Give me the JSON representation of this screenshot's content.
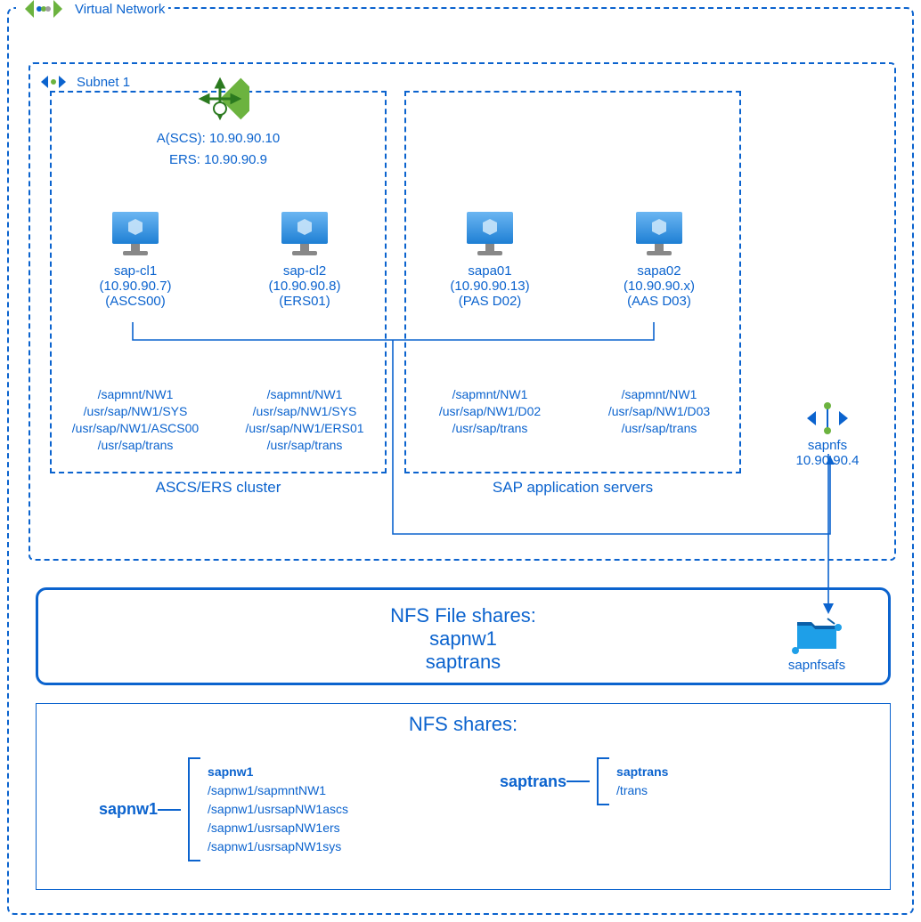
{
  "colors": {
    "primary": "#0B63CE",
    "lb_green": "#6CB33F"
  },
  "vnet": {
    "label": "Virtual Network"
  },
  "subnet": {
    "label": "Subnet 1"
  },
  "load_balancer": {
    "ascs_label": "A(SCS): 10.90.90.10",
    "ers_label": "ERS: 10.90.90.9"
  },
  "clusters": {
    "ascs_ers": {
      "caption": "ASCS/ERS cluster",
      "vm1": {
        "name": "sap-cl1",
        "ip": "(10.90.90.7)",
        "role": "(ASCS00)"
      },
      "vm2": {
        "name": "sap-cl2",
        "ip": "(10.90.90.8)",
        "role": "(ERS01)"
      },
      "mounts1": [
        "/sapmnt/NW1",
        "/usr/sap/NW1/SYS",
        "/usr/sap/NW1/ASCS00",
        "/usr/sap/trans"
      ],
      "mounts2": [
        "/sapmnt/NW1",
        "/usr/sap/NW1/SYS",
        "/usr/sap/NW1/ERS01",
        "/usr/sap/trans"
      ]
    },
    "app": {
      "caption": "SAP application servers",
      "vm1": {
        "name": "sapa01",
        "ip": "(10.90.90.13)",
        "role": "(PAS D02)"
      },
      "vm2": {
        "name": "sapa02",
        "ip": "(10.90.90.x)",
        "role": "(AAS D03)"
      },
      "mounts1": [
        "/sapmnt/NW1",
        "/usr/sap/NW1/D02",
        "/usr/sap/trans"
      ],
      "mounts2": [
        "/sapmnt/NW1",
        "/usr/sap/NW1/D03",
        "/usr/sap/trans"
      ]
    }
  },
  "sapnfs": {
    "name": "sapnfs",
    "ip": "10.90.90.4"
  },
  "nfs_file_shares": {
    "title": "NFS File shares:",
    "share1": "sapnw1",
    "share2": "saptrans"
  },
  "sapnfsafs": {
    "label": "sapnfsafs"
  },
  "nfs_shares": {
    "title": "NFS shares:",
    "left": {
      "name": "sapnw1",
      "header": "sapnw1",
      "paths": [
        "/sapnw1/sapmntNW1",
        "/sapnw1/usrsapNW1ascs",
        "/sapnw1/usrsapNW1ers",
        "/sapnw1/usrsapNW1sys"
      ]
    },
    "right": {
      "name": "saptrans",
      "header": "saptrans",
      "paths": [
        "/trans"
      ]
    }
  }
}
